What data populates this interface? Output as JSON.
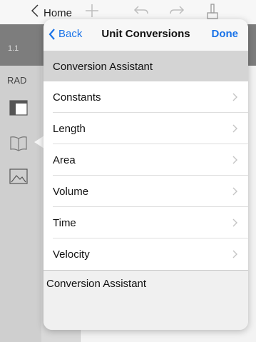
{
  "app": {
    "home_label": "Home",
    "tab_label": "1.1",
    "mode_label": "RAD"
  },
  "popover": {
    "back_label": "Back",
    "title": "Unit Conversions",
    "done_label": "Done",
    "selected_item": "Conversion Assistant",
    "items": [
      {
        "label": "Constants"
      },
      {
        "label": "Length"
      },
      {
        "label": "Area"
      },
      {
        "label": "Volume"
      },
      {
        "label": "Time"
      },
      {
        "label": "Velocity"
      }
    ],
    "footer_label": "Conversion Assistant"
  },
  "colors": {
    "accent": "#1a73e8"
  },
  "icons": {
    "toolbar": [
      "back-chevron-icon",
      "add-icon",
      "undo-icon",
      "redo-icon",
      "tools-icon"
    ],
    "sidebar": [
      "page-layout-icon",
      "book-icon",
      "image-icon"
    ]
  }
}
